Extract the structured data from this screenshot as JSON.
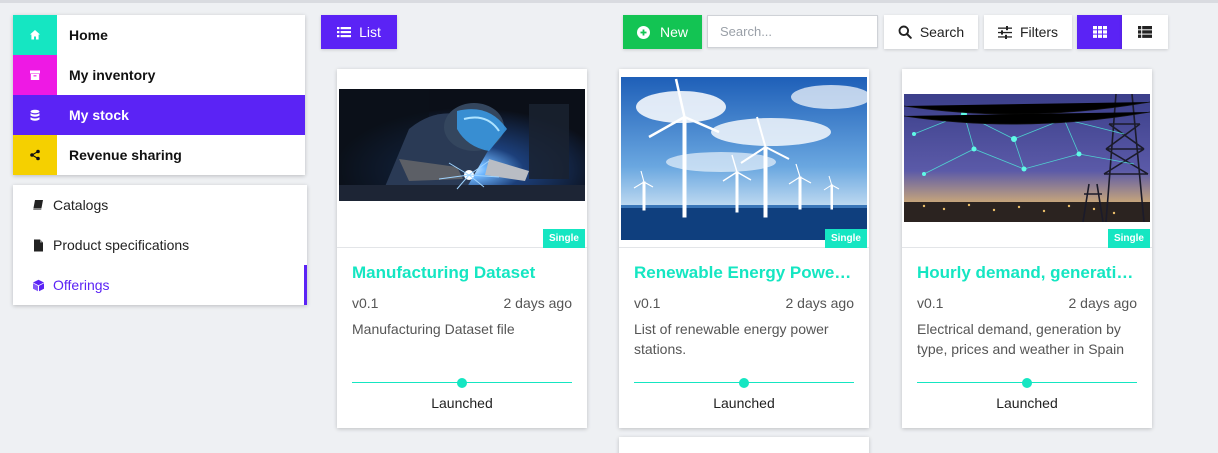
{
  "colors": {
    "accent": "#5b23f5",
    "teal": "#15e6c2",
    "green": "#13c453",
    "magenta": "#ee19e4",
    "yellow": "#f5d000"
  },
  "sidebar": {
    "items": [
      {
        "label": "Home",
        "icon": "home-icon",
        "color": "#15e6c2"
      },
      {
        "label": "My inventory",
        "icon": "archive-icon",
        "color": "#ee19e4"
      },
      {
        "label": "My stock",
        "icon": "database-icon",
        "color": "#5b23f5",
        "active": true
      },
      {
        "label": "Revenue sharing",
        "icon": "share-icon",
        "color": "#f5d000"
      }
    ],
    "submenu": [
      {
        "label": "Catalogs",
        "icon": "book-icon"
      },
      {
        "label": "Product specifications",
        "icon": "file-icon"
      },
      {
        "label": "Offerings",
        "icon": "cube-icon",
        "active": true
      }
    ]
  },
  "toolbar": {
    "list_label": "List",
    "new_label": "New",
    "search_placeholder": "Search...",
    "search_label": "Search",
    "filters_label": "Filters"
  },
  "cards": [
    {
      "title": "Manufacturing Dataset",
      "badge": "Single",
      "version": "v0.1",
      "date": "2 days ago",
      "description": "Manufacturing Dataset file",
      "status": "Launched",
      "progress": 0.5,
      "image": "welder-photo"
    },
    {
      "title": "Renewable Energy Power Stations",
      "badge": "Single",
      "version": "v0.1",
      "date": "2 days ago",
      "description": "List of renewable energy power stations.",
      "status": "Launched",
      "progress": 0.5,
      "image": "wind-turbines-photo"
    },
    {
      "title": "Hourly demand, generation and prices",
      "badge": "Single",
      "version": "v0.1",
      "date": "2 days ago",
      "description": "Electrical demand, generation by type, prices and weather in Spain",
      "status": "Launched",
      "progress": 0.5,
      "image": "power-grid-photo"
    }
  ]
}
